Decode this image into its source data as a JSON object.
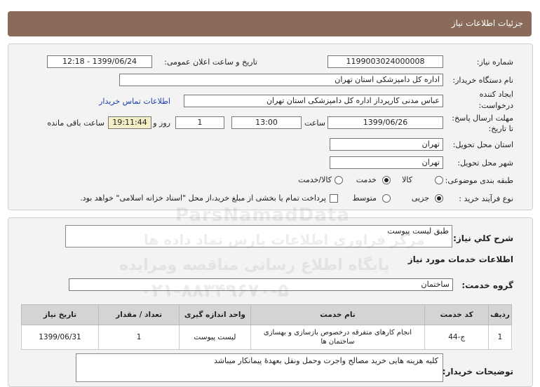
{
  "header": {
    "title": "جزئیات اطلاعات نیاز"
  },
  "fields": {
    "need_number_label": "شماره نیاز:",
    "need_number": "1199003024000008",
    "announce_label": "تاریخ و ساعت اعلان عمومی:",
    "announce_value": "1399/06/24 - 12:18",
    "buyer_org_label": "نام دستگاه خریدار:",
    "buyer_org": "اداره کل  دامپزشکی استان  تهران",
    "creator_label_1": "ایجاد کننده",
    "creator_label_2": "درخواست:",
    "creator": "عباس  مدنی کارپرداز اداره کل  دامپزشکی استان  تهران",
    "contact_link": "اطلاعات تماس خریدار",
    "deadline_label_1": "مهلت ارسال پاسخ:",
    "deadline_label_2": "تا تاریخ:",
    "deadline_date": "1399/06/26",
    "time_label": "ساعت",
    "deadline_time": "13:00",
    "days_value": "1",
    "days_label": "روز و",
    "remaining_time": "19:11:44",
    "remaining_label": "ساعت باقی مانده",
    "province_label": "استان محل تحویل:",
    "province": "تهران",
    "city_label": "شهر محل تحویل:",
    "city": "تهران",
    "category_label": "طبقه بندی موضوعی:",
    "category_options": [
      "کالا",
      "خدمت",
      "کالا/خدمت"
    ],
    "process_label": "نوع فرآیند خرید :",
    "process_options": [
      "جزیی",
      "متوسط"
    ],
    "payment_note": "پرداخت تمام یا بخشی از مبلغ خرید،از محل \"اسناد خزانه اسلامی\" خواهد بود."
  },
  "summary": {
    "desc_label": "شرح کلي نياز:",
    "desc_value": "طبق لیست پیوست",
    "services_title": "اطلاعات خدمات مورد نیاز",
    "group_label": "گروه خدمت:",
    "group_value": "ساختمان"
  },
  "table": {
    "headers": [
      "ردیف",
      "کد خدمت",
      "نام خدمت",
      "واحد اندازه گیری",
      "تعداد / مقدار",
      "تاریخ نیاز"
    ],
    "rows": [
      [
        "1",
        "ج-44",
        "انجام کارهای متفرقه درخصوص بازسازی و بهسازی ساختمان ها",
        "لیست پیوست",
        "1",
        "1399/06/31"
      ]
    ]
  },
  "notes": {
    "label": "توضیحات خریدار:",
    "value": "کلیه هزینه هایی خرید مصالح واجرت وحمل ونقل بعهدهٔ پیمانکار میباشد"
  },
  "watermark": {
    "brand": "ParsNamadData",
    "line1": "مرکز فراوری اطلاعات پارس نماد داده ها",
    "line2": "پایگاه اطلاع رسانی مناقصه ومزایده",
    "phone": "۰۲۱-۸۸۳۴۹۶۷۰-۵"
  },
  "colors": {
    "header_bg": "#8a6a58",
    "link": "#1a3fb0",
    "remaining_bg": "#f3f0c8"
  }
}
